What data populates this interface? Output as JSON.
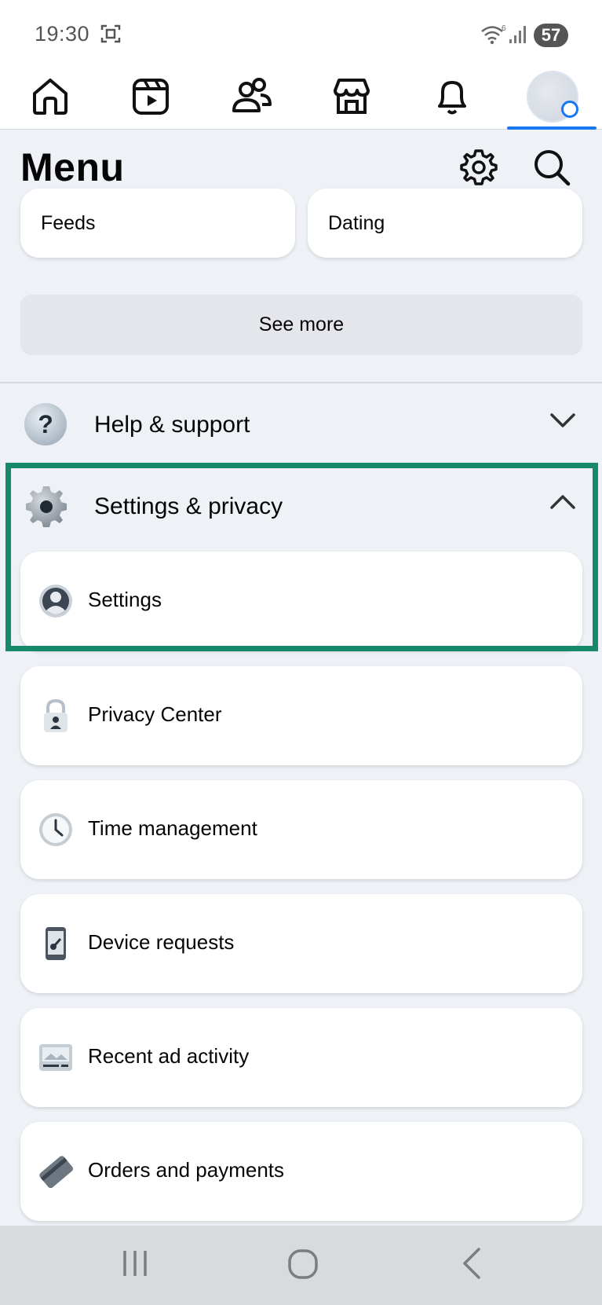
{
  "status_bar": {
    "time": "19:30",
    "battery": "57",
    "network_label": "6"
  },
  "top_nav": {
    "items": [
      "home",
      "video",
      "friends",
      "marketplace",
      "notifications",
      "profile"
    ],
    "active": "profile"
  },
  "menu": {
    "title": "Menu"
  },
  "shortcuts": [
    {
      "label": "Feeds"
    },
    {
      "label": "Dating"
    }
  ],
  "see_more": {
    "label": "See more"
  },
  "sections": {
    "help": {
      "label": "Help & support",
      "icon": "question-icon",
      "expanded": false
    },
    "settings_privacy": {
      "label": "Settings & privacy",
      "icon": "gear-icon",
      "expanded": true
    }
  },
  "settings_items": [
    {
      "label": "Settings",
      "icon": "person-circle-icon"
    },
    {
      "label": "Privacy Center",
      "icon": "lock-icon"
    },
    {
      "label": "Time management",
      "icon": "clock-icon"
    },
    {
      "label": "Device requests",
      "icon": "phone-key-icon"
    },
    {
      "label": "Recent ad activity",
      "icon": "ad-image-icon"
    },
    {
      "label": "Orders and payments",
      "icon": "card-icon"
    }
  ],
  "colors": {
    "accent": "#1877f2",
    "highlight": "#16896c",
    "background": "#eef1f6"
  }
}
